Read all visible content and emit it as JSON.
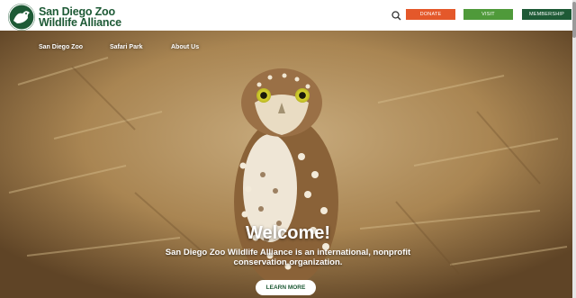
{
  "header": {
    "logo": {
      "line1": "San Diego Zoo",
      "line2": "Wildlife Alliance"
    },
    "search_icon": "search-icon",
    "buttons": {
      "donate": "DONATE",
      "visit": "VISIT",
      "membership": "MEMBERSHIP"
    }
  },
  "nav": {
    "items": [
      "San Diego Zoo",
      "Safari Park",
      "About Us"
    ]
  },
  "hero": {
    "image": "burrowing-owl-photo",
    "title": "Welcome!",
    "tagline": "San Diego Zoo Wildlife Alliance is an international, nonprofit conservation organization.",
    "cta": "LEARN MORE"
  },
  "colors": {
    "brand_green": "#1e5a36",
    "donate_orange": "#e4582a",
    "visit_green": "#4f9a3a"
  }
}
